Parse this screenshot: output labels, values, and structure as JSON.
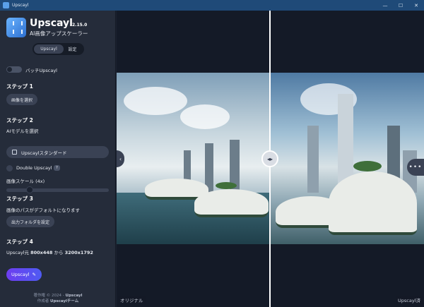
{
  "window": {
    "title": "Upscayl",
    "controls": [
      "—",
      "☐",
      "✕"
    ]
  },
  "app": {
    "name": "Upscayl",
    "version": "2.15.0",
    "subtitle": "AI画像アップスケーラー"
  },
  "tabs": [
    {
      "label": "Upscayl",
      "active": true
    },
    {
      "label": "設定",
      "active": false
    }
  ],
  "batch": {
    "label": "バッチUpscayl",
    "enabled": false
  },
  "step1": {
    "heading": "ステップ 1",
    "button": "画像を選択"
  },
  "step2": {
    "heading": "ステップ 2",
    "model_label": "AIモデルを選択",
    "model_value": "Upscaylスタンダード",
    "double_label": "Double Upscayl",
    "double_help": "?",
    "scale_label": "画像スケール (4x)",
    "scale_value": 4
  },
  "step3": {
    "heading": "ステップ 3",
    "info": "画像のパスがデフォルトになります",
    "button": "出力フォルダを設定"
  },
  "step4": {
    "heading": "ステップ 4",
    "info_prefix": "Upscayl元",
    "from_size": "800x448",
    "info_mid": "から",
    "to_size": "3200x1792",
    "button": "Upscayl"
  },
  "footer": {
    "copyright_prefix": "著作権 © 2024 -",
    "copyright_name": "Upscayl",
    "author_prefix": "作成者",
    "author_name": "Upscaylチーム"
  },
  "viewer": {
    "left_label": "オリジナル",
    "right_label": "Upscayl済",
    "more": "•••"
  },
  "colors": {
    "accent": "#6d3df0",
    "sidebar": "#252c3a",
    "titlebar": "#1f4a78"
  }
}
